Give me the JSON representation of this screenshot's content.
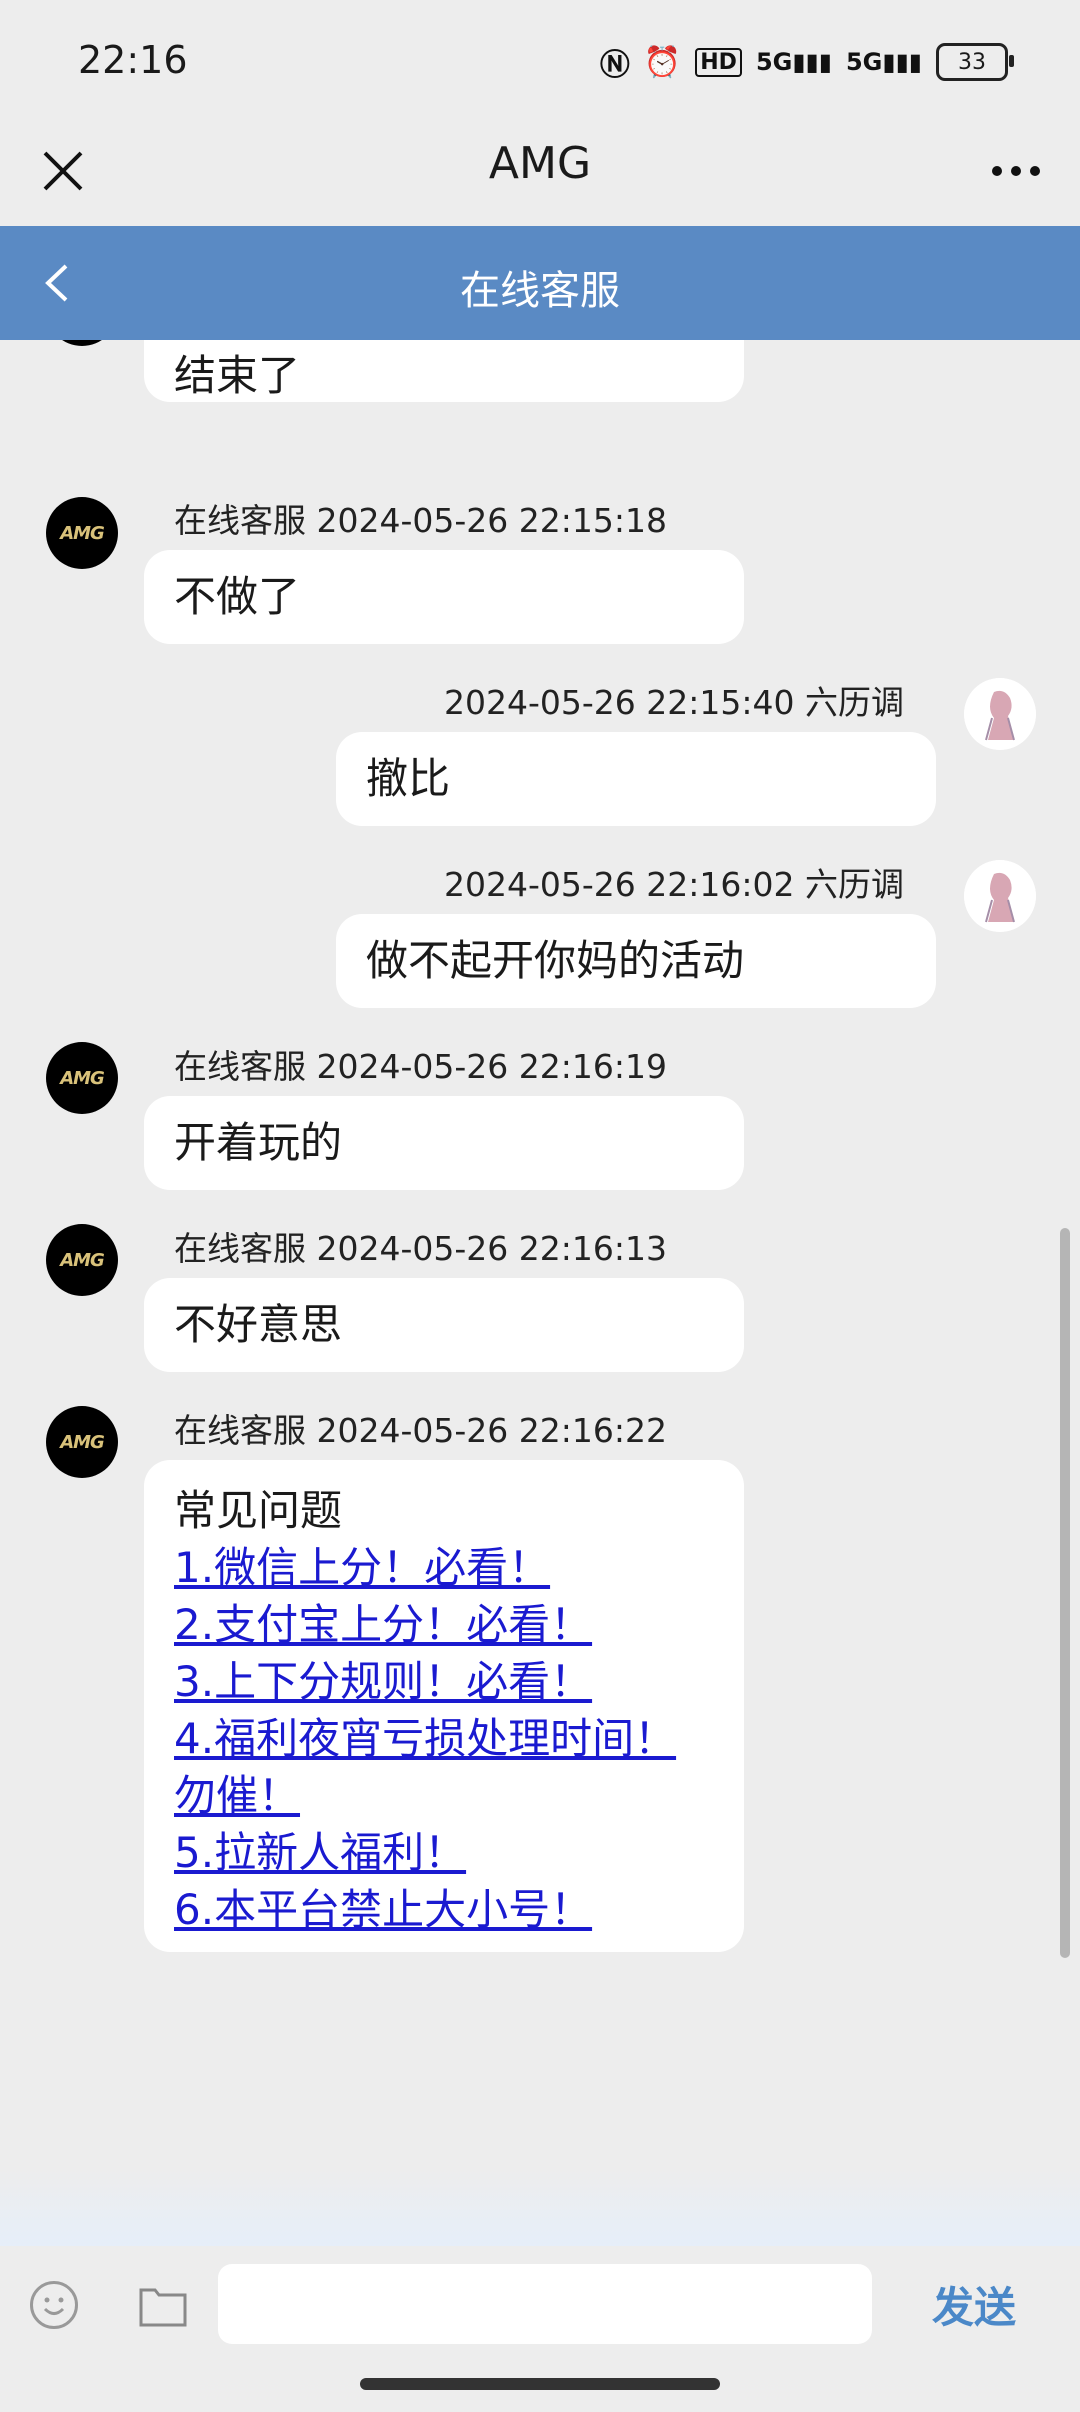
{
  "status_bar": {
    "time": "22:16",
    "icons": [
      "nfc-icon",
      "alarm-icon",
      "hd-icon",
      "signal-5g-icon",
      "signal-5g-icon-2"
    ],
    "battery": "33"
  },
  "title_bar": {
    "title": "AMG"
  },
  "chat_header": {
    "title": "在线客服"
  },
  "messages": [
    {
      "side": "agent",
      "text": "结束了"
    },
    {
      "side": "agent",
      "meta": "在线客服 2024-05-26 22:15:18",
      "text": "不做了"
    },
    {
      "side": "user",
      "meta": "2024-05-26 22:15:40 六历调",
      "text": "撤比"
    },
    {
      "side": "user",
      "meta": "2024-05-26 22:16:02 六历调",
      "text": "做不起开你妈的活动"
    },
    {
      "side": "agent",
      "meta": "在线客服 2024-05-26 22:16:19",
      "text": "开着玩的"
    },
    {
      "side": "agent",
      "meta": "在线客服 2024-05-26 22:16:13",
      "text": "不好意思"
    },
    {
      "side": "agent",
      "meta": "在线客服 2024-05-26 22:16:22",
      "faq_title": "常见问题",
      "links": [
        "1.微信上分！必看！",
        "2.支付宝上分！必看！",
        "3.上下分规则！必看！",
        "4.福利夜宵亏损处理时间！",
        "勿催！",
        "5.拉新人福利！",
        "6.本平台禁止大小号！"
      ]
    }
  ],
  "agent_avatar_text": "AMG",
  "composer": {
    "placeholder": "",
    "send_label": "发送"
  }
}
